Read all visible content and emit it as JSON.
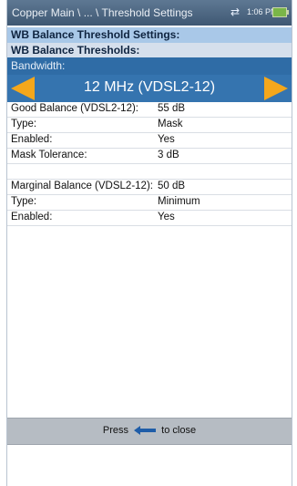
{
  "titlebar": {
    "title": "Copper Main \\ ... \\ Threshold Settings",
    "network_icon": "⇄",
    "time": "1:06 PM",
    "battery_icon": "battery-icon"
  },
  "headers": {
    "settings": "WB Balance Threshold Settings:",
    "thresholds": "WB Balance Thresholds:"
  },
  "bandwidth": {
    "label": "Bandwidth:",
    "value": "12 MHz (VDSL2-12)",
    "prev_icon": "arrow-left-icon",
    "next_icon": "arrow-right-icon"
  },
  "rows": [
    {
      "label": "Good Balance (VDSL2-12):",
      "value": "55 dB"
    },
    {
      "label": "Type:",
      "value": "Mask"
    },
    {
      "label": "Enabled:",
      "value": "Yes"
    },
    {
      "label": "Mask Tolerance:",
      "value": "3 dB"
    },
    {
      "label": "",
      "value": ""
    },
    {
      "label": "Marginal Balance (VDSL2-12):",
      "value": "50 dB"
    },
    {
      "label": "Type:",
      "value": "Minimum"
    },
    {
      "label": "Enabled:",
      "value": "Yes"
    }
  ],
  "footer": {
    "press": "Press",
    "close": "to close",
    "icon": "back-arrow-icon"
  },
  "colors": {
    "accent": "#3574af",
    "arrow": "#f4a71c",
    "header_dark": "#a9c8e8",
    "header_light": "#d5dfec"
  }
}
